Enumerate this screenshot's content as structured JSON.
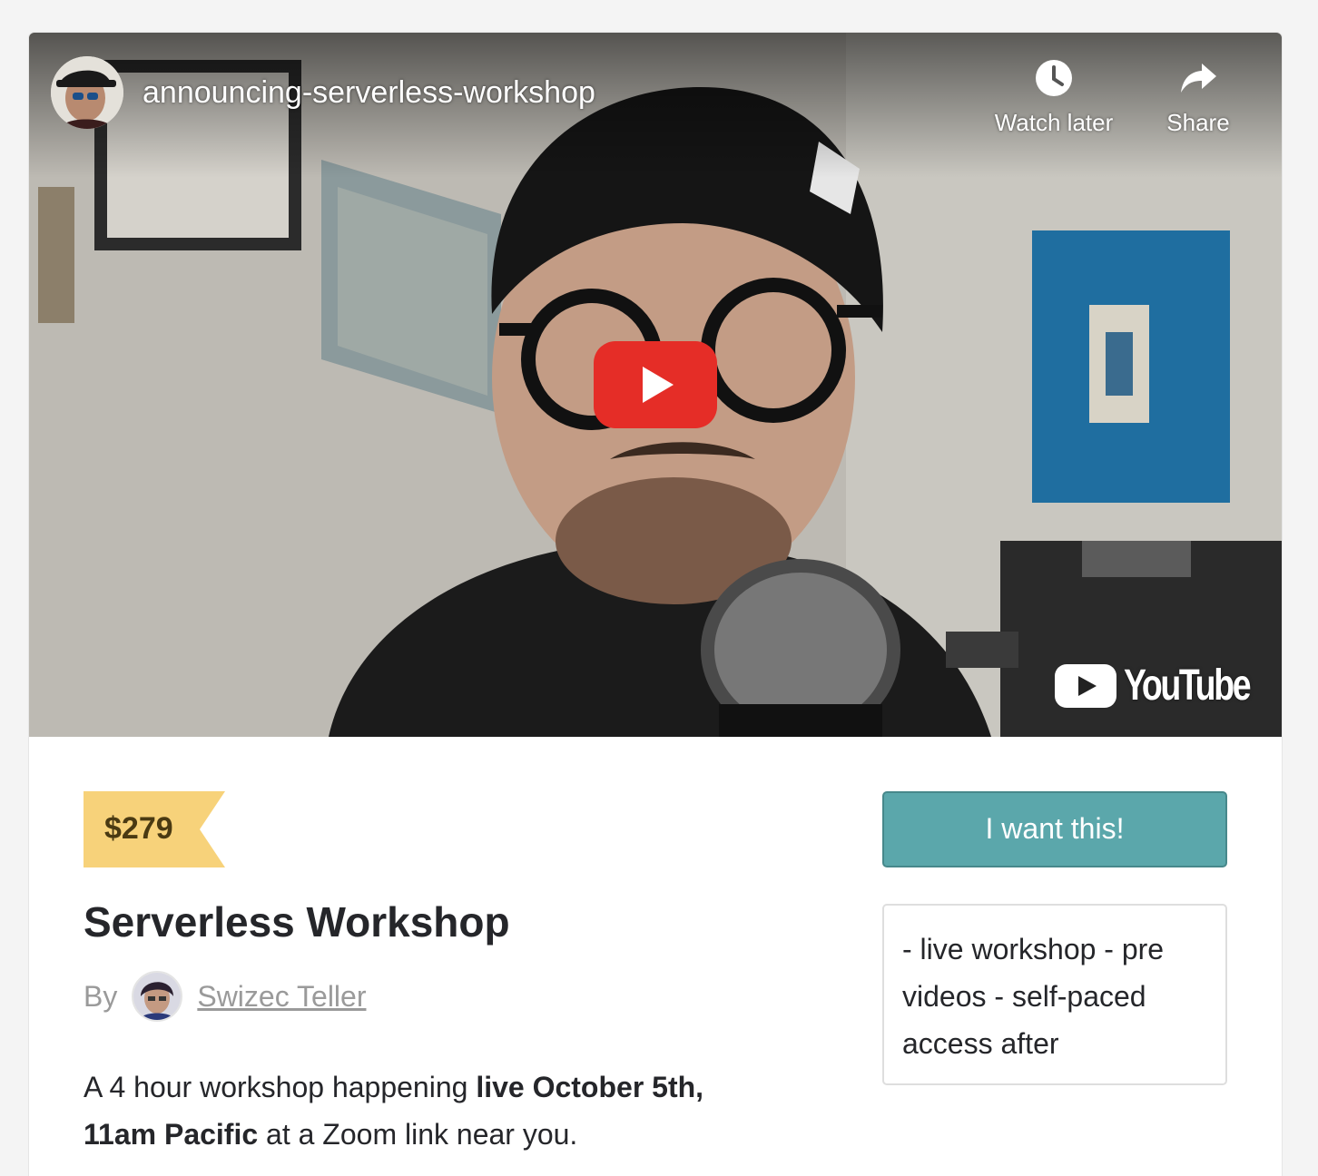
{
  "video": {
    "title": "announcing-serverless-workshop",
    "watch_later_label": "Watch later",
    "share_label": "Share",
    "brand": "YouTube",
    "icons": {
      "watch_later": "clock-icon",
      "share": "share-arrow-icon",
      "play": "play-icon"
    }
  },
  "product": {
    "price": "$279",
    "title": "Serverless Workshop",
    "by_label": "By",
    "author_name": "Swizec Teller",
    "description": {
      "part1": "A 4 hour workshop happening ",
      "bold": "live October 5th, 11am Pacific",
      "part2": " at a Zoom link near you."
    },
    "cta_label": "I want this!",
    "summary": "- live workshop - pre videos - self-paced access after"
  },
  "colors": {
    "price_tag": "#f7d27a",
    "cta": "#5ba7ab",
    "play_red": "#e52d27"
  }
}
